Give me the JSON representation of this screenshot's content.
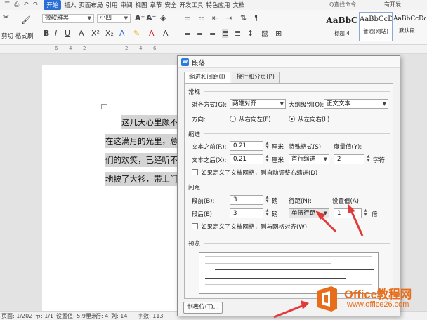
{
  "menubar": {
    "quick_access": [
      "☰",
      "⎙",
      "↶",
      "↷"
    ],
    "start_tab": "开始",
    "tabs": [
      "插入",
      "页面布局",
      "引用",
      "审阅",
      "视图",
      "章节",
      "安全",
      "开发工具",
      "特色应用",
      "文档"
    ],
    "search": "Q查找命令...",
    "new_version": "有开发"
  },
  "toolbar": {
    "cut_label": "剪切",
    "format_painter_label": "格式刷",
    "font_family": "微软雅黑",
    "font_size": "小四",
    "styles": [
      {
        "sample": "AaBbC",
        "name": "标题 4"
      },
      {
        "sample": "AaBbCcD",
        "name": "普通(网站)"
      },
      {
        "sample": "AaBbCcDd",
        "name": "默认段..."
      }
    ]
  },
  "ruler": {
    "ticks": [
      "6",
      "4",
      "2",
      "",
      "2",
      "4",
      "6"
    ]
  },
  "document": {
    "lines": [
      "这几天心里颇不",
      "在这满月的光里，总",
      "们的欢笑，已经听不",
      "地披了大衫，带上门"
    ]
  },
  "statusbar": {
    "page": "页码: 1",
    "pages": "页面: 1/202",
    "section": "节: 1/1",
    "setting": "设置值: 5.9厘米",
    "row": "行: 4",
    "col": "列: 14",
    "words": "字数: 113"
  },
  "dialog": {
    "title": "段落",
    "tabs": [
      "缩进和间距(I)",
      "换行和分页(P)"
    ],
    "general": {
      "section": "常规",
      "align_label": "对齐方式(G):",
      "align_value": "两端对齐",
      "outline_label": "大纲级别(O):",
      "outline_value": "正文文本",
      "direction_label": "方向:",
      "rtl": "从右向左(F)",
      "ltr": "从左向右(L)"
    },
    "indent": {
      "section": "缩进",
      "before_label": "文本之前(R):",
      "before_value": "0.21",
      "before_unit": "厘米",
      "after_label": "文本之后(X):",
      "after_value": "0.21",
      "after_unit": "厘米",
      "special_label": "特殊格式(S):",
      "special_value": "首行缩进",
      "measure_label": "度量值(Y):",
      "measure_value": "2",
      "measure_unit": "字符",
      "grid_check": "如果定义了文档网格，则自动调整右缩进(D)"
    },
    "spacing": {
      "section": "间距",
      "before_label": "段前(B):",
      "before_value": "3",
      "before_unit": "磅",
      "after_label": "段后(E):",
      "after_value": "3",
      "after_unit": "磅",
      "line_label": "行距(N):",
      "line_value": "单倍行距",
      "setting_label": "设置值(A):",
      "setting_value": "1",
      "setting_unit": "倍",
      "grid_check": "如果定义了文档网格，则与网格对齐(W)"
    },
    "preview": {
      "section": "预览"
    },
    "tabs_button": "制表位(T)..."
  },
  "watermark": {
    "brand": "Office教程网",
    "url": "www.office26.com"
  },
  "colors": {
    "accent": "#2b6fd6",
    "annotation_red": "#e23a3a",
    "brand_orange": "#e86d1a"
  }
}
